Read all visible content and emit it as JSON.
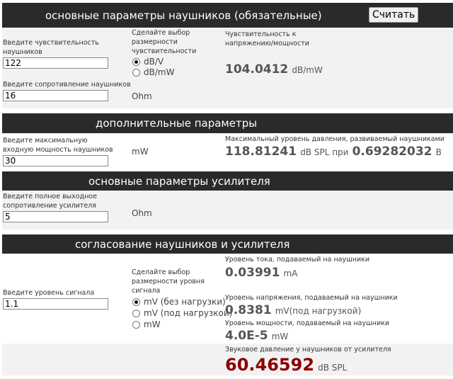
{
  "section1": {
    "title": "основные параметры наушников (обязательные)",
    "calc_button": "Считать",
    "sens_prompt": "Введите чувствительность наушников",
    "sens_value": "122",
    "dim_prompt": "Сделайте выбор размерности чувствительности",
    "dim_options": [
      "dB/V",
      "dB/mW"
    ],
    "result_label": "Чувствительность к напряжению/мощности",
    "result_value": "104.0412",
    "result_unit": "dB/mW",
    "imp_prompt": "Введите сопротивление наушников",
    "imp_value": "16",
    "imp_unit": "Ohm"
  },
  "section2": {
    "title": "дополнительные параметры",
    "power_prompt": "Введите максимальную входную мощность наушников",
    "power_value": "30",
    "power_unit": "mW",
    "result_label": "Максимальный уровень давления, развиваемый наушниками",
    "spl_value": "118.81241",
    "spl_unit": "dB SPL при",
    "volt_value": "0.69282032",
    "volt_unit": "В"
  },
  "section3": {
    "title": "основные параметры усилителя",
    "out_prompt": "Введите полное выходное сопротивление усилителя",
    "out_value": "5",
    "out_unit": "Ohm"
  },
  "section4": {
    "title": "согласование наушников и усилителя",
    "signal_prompt": "Введите уровень сигнала",
    "signal_value": "1.1",
    "dim_prompt": "Сделайте выбор размерности уровня сигнала",
    "dim_options": [
      "mV (без нагрузки)",
      "mV (под нагрузкой)",
      "mW"
    ],
    "current_label": "Уровень тока, подаваемый на наушники",
    "current_value": "0.03991",
    "current_unit": "mA",
    "voltage_label": "Уровень напряжения, подаваемый на наушники",
    "voltage_value": "0.8381",
    "voltage_unit": "mV(под нагрузкой)",
    "power_label": "Уровень мощности, подаваемый на наушники",
    "power_value": "4.0E-5",
    "power_unit": "mW",
    "spl_label": "Звуковое давление у наушников от усилителя",
    "spl_value": "60.46592",
    "spl_unit": "dB SPL"
  }
}
